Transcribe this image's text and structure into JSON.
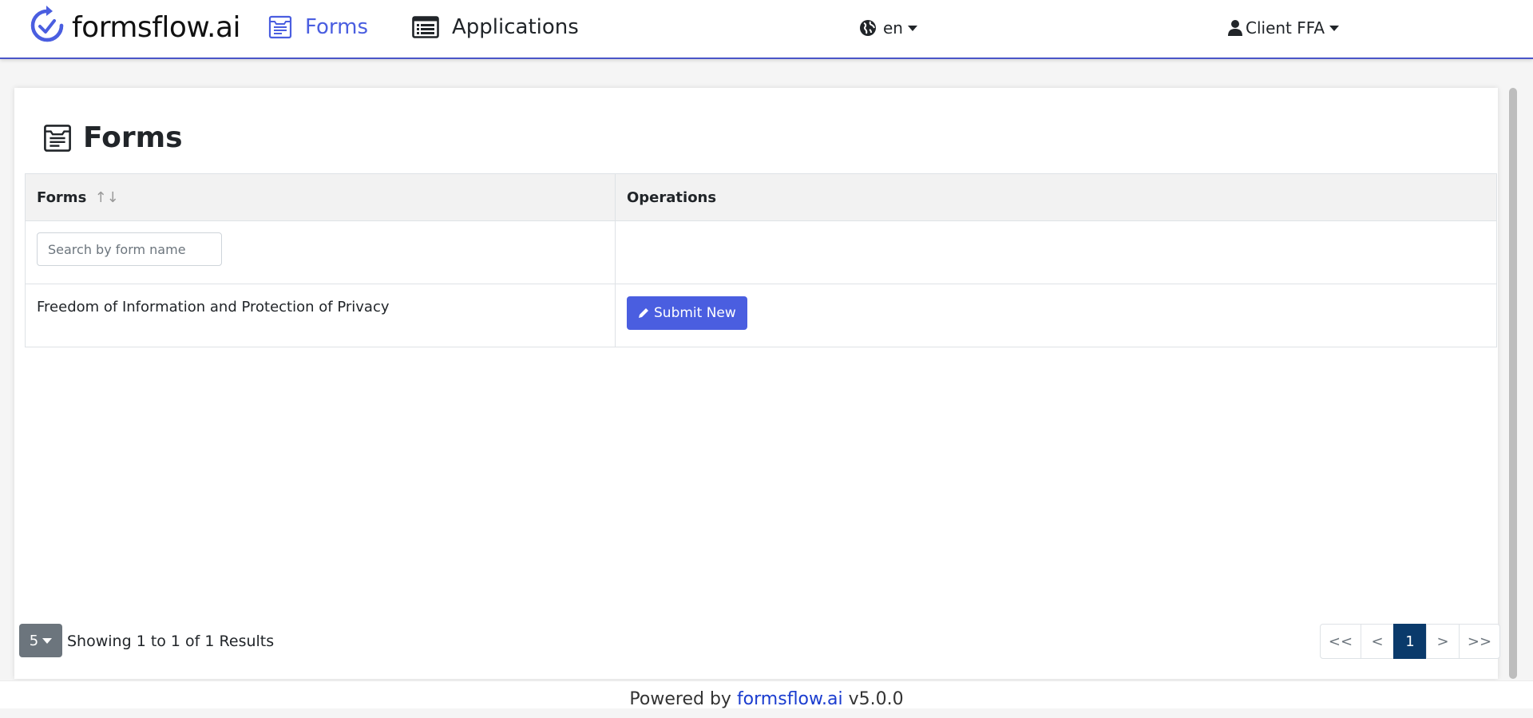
{
  "navbar": {
    "brand": "formsflow.ai",
    "items": [
      {
        "label": "Forms",
        "icon": "forms-icon",
        "active": true
      },
      {
        "label": "Applications",
        "icon": "list-icon",
        "active": false
      }
    ],
    "language": "en",
    "user": "Client FFA",
    "accent_color": "#4a5ee0"
  },
  "main": {
    "title": "Forms",
    "table": {
      "columns": [
        {
          "label": "Forms",
          "sort_indicator": "↑↓"
        },
        {
          "label": "Operations"
        }
      ],
      "search_placeholder": "Search by form name",
      "rows": [
        {
          "name": "Freedom of Information and Protection of Privacy",
          "action": "Submit New"
        }
      ]
    },
    "page_size": "5",
    "results_text": "Showing 1 to 1 of 1 Results",
    "pagination": [
      "<<",
      "<",
      "1",
      ">",
      ">>"
    ],
    "current_page": "1"
  },
  "footer": {
    "prefix": "Powered by",
    "link": "formsflow.ai",
    "version": "v5.0.0"
  }
}
